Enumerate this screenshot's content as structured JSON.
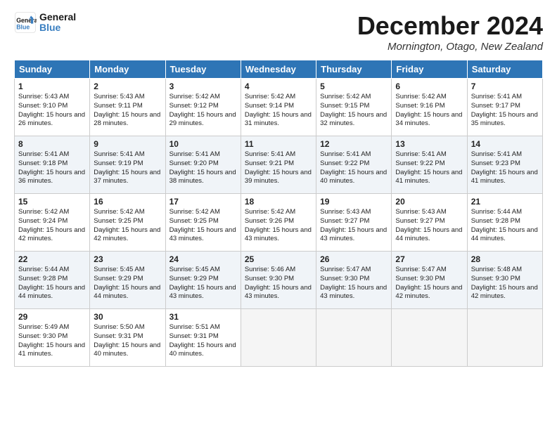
{
  "logo": {
    "line1": "General",
    "line2": "Blue"
  },
  "title": "December 2024",
  "location": "Mornington, Otago, New Zealand",
  "headers": [
    "Sunday",
    "Monday",
    "Tuesday",
    "Wednesday",
    "Thursday",
    "Friday",
    "Saturday"
  ],
  "weeks": [
    [
      {
        "day": "1",
        "sunrise": "5:43 AM",
        "sunset": "9:10 PM",
        "daylight": "15 hours and 26 minutes."
      },
      {
        "day": "2",
        "sunrise": "5:43 AM",
        "sunset": "9:11 PM",
        "daylight": "15 hours and 28 minutes."
      },
      {
        "day": "3",
        "sunrise": "5:42 AM",
        "sunset": "9:12 PM",
        "daylight": "15 hours and 29 minutes."
      },
      {
        "day": "4",
        "sunrise": "5:42 AM",
        "sunset": "9:14 PM",
        "daylight": "15 hours and 31 minutes."
      },
      {
        "day": "5",
        "sunrise": "5:42 AM",
        "sunset": "9:15 PM",
        "daylight": "15 hours and 32 minutes."
      },
      {
        "day": "6",
        "sunrise": "5:42 AM",
        "sunset": "9:16 PM",
        "daylight": "15 hours and 34 minutes."
      },
      {
        "day": "7",
        "sunrise": "5:41 AM",
        "sunset": "9:17 PM",
        "daylight": "15 hours and 35 minutes."
      }
    ],
    [
      {
        "day": "8",
        "sunrise": "5:41 AM",
        "sunset": "9:18 PM",
        "daylight": "15 hours and 36 minutes."
      },
      {
        "day": "9",
        "sunrise": "5:41 AM",
        "sunset": "9:19 PM",
        "daylight": "15 hours and 37 minutes."
      },
      {
        "day": "10",
        "sunrise": "5:41 AM",
        "sunset": "9:20 PM",
        "daylight": "15 hours and 38 minutes."
      },
      {
        "day": "11",
        "sunrise": "5:41 AM",
        "sunset": "9:21 PM",
        "daylight": "15 hours and 39 minutes."
      },
      {
        "day": "12",
        "sunrise": "5:41 AM",
        "sunset": "9:22 PM",
        "daylight": "15 hours and 40 minutes."
      },
      {
        "day": "13",
        "sunrise": "5:41 AM",
        "sunset": "9:22 PM",
        "daylight": "15 hours and 41 minutes."
      },
      {
        "day": "14",
        "sunrise": "5:41 AM",
        "sunset": "9:23 PM",
        "daylight": "15 hours and 41 minutes."
      }
    ],
    [
      {
        "day": "15",
        "sunrise": "5:42 AM",
        "sunset": "9:24 PM",
        "daylight": "15 hours and 42 minutes."
      },
      {
        "day": "16",
        "sunrise": "5:42 AM",
        "sunset": "9:25 PM",
        "daylight": "15 hours and 42 minutes."
      },
      {
        "day": "17",
        "sunrise": "5:42 AM",
        "sunset": "9:25 PM",
        "daylight": "15 hours and 43 minutes."
      },
      {
        "day": "18",
        "sunrise": "5:42 AM",
        "sunset": "9:26 PM",
        "daylight": "15 hours and 43 minutes."
      },
      {
        "day": "19",
        "sunrise": "5:43 AM",
        "sunset": "9:27 PM",
        "daylight": "15 hours and 43 minutes."
      },
      {
        "day": "20",
        "sunrise": "5:43 AM",
        "sunset": "9:27 PM",
        "daylight": "15 hours and 44 minutes."
      },
      {
        "day": "21",
        "sunrise": "5:44 AM",
        "sunset": "9:28 PM",
        "daylight": "15 hours and 44 minutes."
      }
    ],
    [
      {
        "day": "22",
        "sunrise": "5:44 AM",
        "sunset": "9:28 PM",
        "daylight": "15 hours and 44 minutes."
      },
      {
        "day": "23",
        "sunrise": "5:45 AM",
        "sunset": "9:29 PM",
        "daylight": "15 hours and 44 minutes."
      },
      {
        "day": "24",
        "sunrise": "5:45 AM",
        "sunset": "9:29 PM",
        "daylight": "15 hours and 43 minutes."
      },
      {
        "day": "25",
        "sunrise": "5:46 AM",
        "sunset": "9:30 PM",
        "daylight": "15 hours and 43 minutes."
      },
      {
        "day": "26",
        "sunrise": "5:47 AM",
        "sunset": "9:30 PM",
        "daylight": "15 hours and 43 minutes."
      },
      {
        "day": "27",
        "sunrise": "5:47 AM",
        "sunset": "9:30 PM",
        "daylight": "15 hours and 42 minutes."
      },
      {
        "day": "28",
        "sunrise": "5:48 AM",
        "sunset": "9:30 PM",
        "daylight": "15 hours and 42 minutes."
      }
    ],
    [
      {
        "day": "29",
        "sunrise": "5:49 AM",
        "sunset": "9:30 PM",
        "daylight": "15 hours and 41 minutes."
      },
      {
        "day": "30",
        "sunrise": "5:50 AM",
        "sunset": "9:31 PM",
        "daylight": "15 hours and 40 minutes."
      },
      {
        "day": "31",
        "sunrise": "5:51 AM",
        "sunset": "9:31 PM",
        "daylight": "15 hours and 40 minutes."
      },
      null,
      null,
      null,
      null
    ]
  ]
}
